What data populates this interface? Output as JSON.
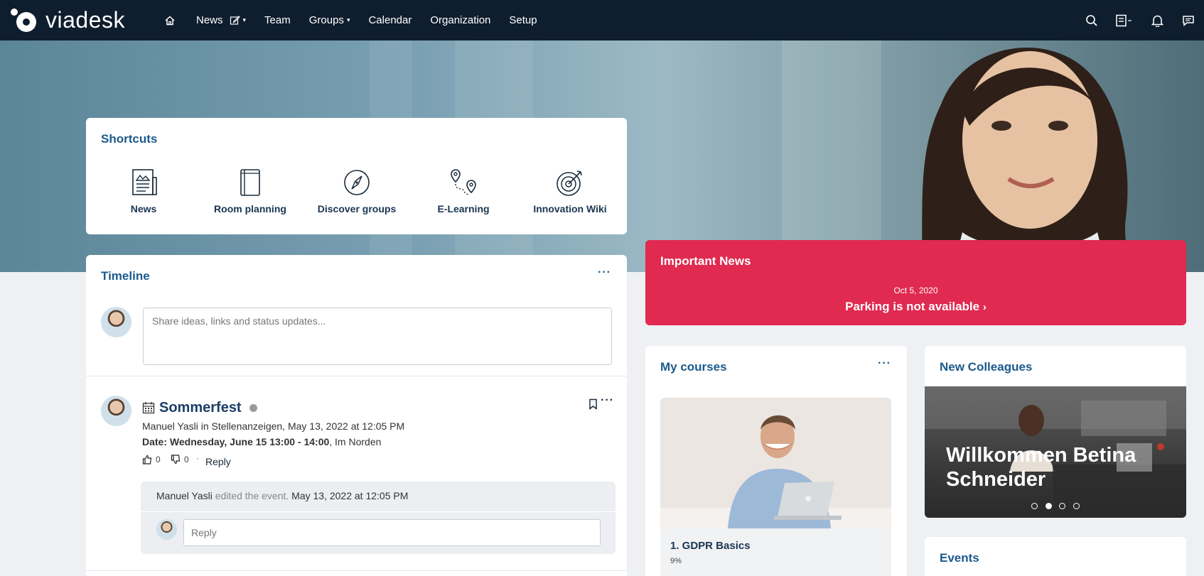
{
  "brand": {
    "name": "viadesk"
  },
  "nav": {
    "items": [
      {
        "label": "News",
        "has_edit_icon": true,
        "has_dropdown": true
      },
      {
        "label": "Team"
      },
      {
        "label": "Groups",
        "has_dropdown": true
      },
      {
        "label": "Calendar"
      },
      {
        "label": "Organization"
      },
      {
        "label": "Setup"
      }
    ],
    "right_icons": [
      "search-icon",
      "tasks-icon",
      "bell-icon",
      "chat-icon"
    ]
  },
  "shortcuts": {
    "title": "Shortcuts",
    "items": [
      {
        "label": "News",
        "icon": "newspaper-icon"
      },
      {
        "label": "Room planning",
        "icon": "book-icon"
      },
      {
        "label": "Discover groups",
        "icon": "compass-icon"
      },
      {
        "label": "E-Learning",
        "icon": "route-icon"
      },
      {
        "label": "Innovation Wiki",
        "icon": "target-icon"
      }
    ]
  },
  "timeline": {
    "title": "Timeline",
    "more": "···",
    "composer_placeholder": "Share ideas, links and status updates...",
    "post": {
      "title": "Sommerfest",
      "author": "Manuel Yasli",
      "in_word": "in",
      "group": "Stellenanzeigen,",
      "datetime": "May 13, 2022 at 12:05 PM",
      "date_label": "Date: Wednesday, June 15 13:00 - 14:00",
      "location": ", Im Norden",
      "likes": "0",
      "dislikes": "0",
      "sep": "·",
      "reply": "Reply",
      "activity": {
        "author": "Manuel Yasli",
        "action": "edited the event.",
        "datetime": "May 13, 2022 at 12:05 PM"
      },
      "reply_placeholder": "Reply"
    }
  },
  "important_news": {
    "title": "Important News",
    "date": "Oct 5, 2020",
    "headline": "Parking is not available",
    "chevron": "›"
  },
  "courses": {
    "title": "My courses",
    "more": "···",
    "item": {
      "title": "1. GDPR Basics",
      "progress": "9%"
    }
  },
  "colleagues": {
    "title": "New Colleagues",
    "slide_text": "Willkommen Betina Schneider",
    "slides": 4,
    "active_slide": 2
  },
  "events": {
    "title": "Events"
  },
  "colors": {
    "nav": "#0f1e2e",
    "accent": "#1b5a8c",
    "important": "#e02a50"
  }
}
